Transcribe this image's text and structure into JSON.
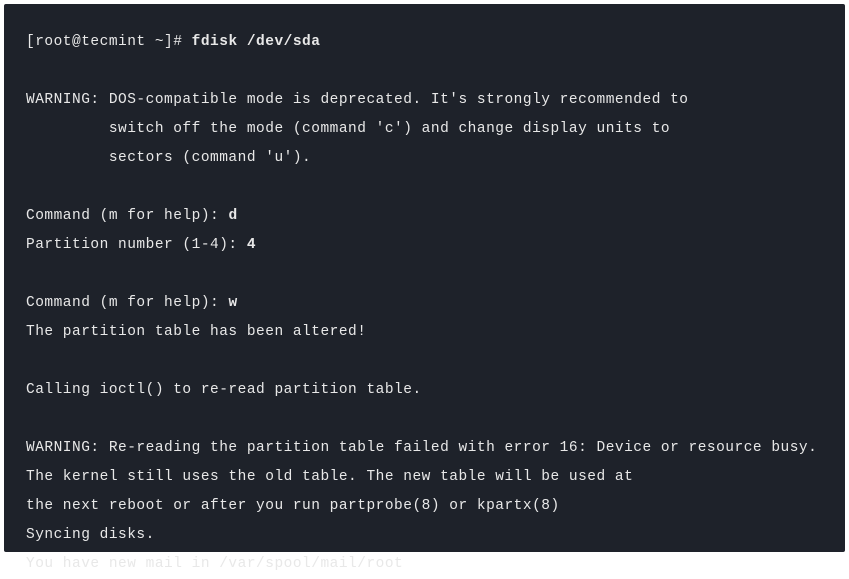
{
  "terminal": {
    "prompt": "[root@tecmint ~]# ",
    "command": "fdisk /dev/sda",
    "warning1_line1": "WARNING: DOS-compatible mode is deprecated. It's strongly recommended to",
    "warning1_line2": "         switch off the mode (command 'c') and change display units to",
    "warning1_line3": "         sectors (command 'u').",
    "cmd1_prompt": "Command (m for help): ",
    "cmd1_input": "d",
    "partition_prompt": "Partition number (1-4): ",
    "partition_input": "4",
    "cmd2_prompt": "Command (m for help): ",
    "cmd2_input": "w",
    "altered_msg": "The partition table has been altered!",
    "ioctl_msg": "Calling ioctl() to re-read partition table.",
    "warning2_line1": "WARNING: Re-reading the partition table failed with error 16: Device or resource busy.",
    "warning2_line2": "The kernel still uses the old table. The new table will be used at",
    "warning2_line3": "the next reboot or after you run partprobe(8) or kpartx(8)",
    "syncing_msg": "Syncing disks.",
    "mail_msg": "You have new mail in /var/spool/mail/root"
  }
}
